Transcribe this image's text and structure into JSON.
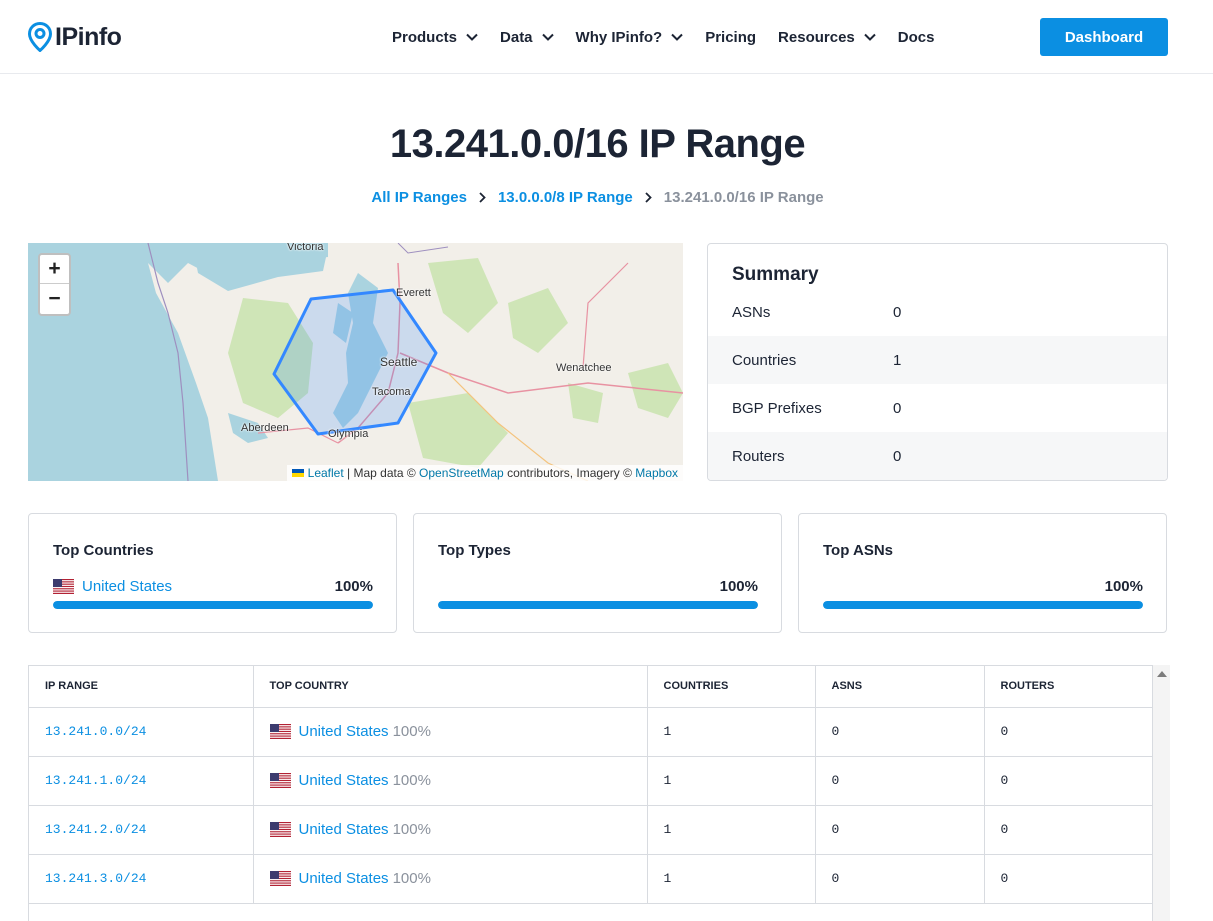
{
  "header": {
    "logo_text": "IPinfo",
    "nav": [
      {
        "label": "Products",
        "has_dropdown": true
      },
      {
        "label": "Data",
        "has_dropdown": true
      },
      {
        "label": "Why IPinfo?",
        "has_dropdown": true
      },
      {
        "label": "Pricing",
        "has_dropdown": false
      },
      {
        "label": "Resources",
        "has_dropdown": true
      },
      {
        "label": "Docs",
        "has_dropdown": false
      }
    ],
    "dashboard_label": "Dashboard"
  },
  "page": {
    "title": "13.241.0.0/16 IP Range",
    "breadcrumb": [
      "All IP Ranges",
      "13.0.0.0/8 IP Range",
      "13.241.0.0/16 IP Range"
    ]
  },
  "map": {
    "zoom_in": "+",
    "zoom_out": "−",
    "labels": [
      "Victoria",
      "Everett",
      "Seattle",
      "Wenatchee",
      "Tacoma",
      "Aberdeen",
      "Olympia"
    ],
    "attribution": {
      "leaflet": "Leaflet",
      "sep1": " | Map data © ",
      "osm": "OpenStreetMap",
      "sep2": " contributors, Imagery © ",
      "mapbox": "Mapbox"
    },
    "colors": {
      "water": "#aad3df",
      "land": "#f2efe9",
      "forest": "#cfe5b7",
      "polygon": "#3388ff"
    }
  },
  "summary": {
    "title": "Summary",
    "rows": [
      {
        "key": "ASNs",
        "value": "0"
      },
      {
        "key": "Countries",
        "value": "1"
      },
      {
        "key": "BGP Prefixes",
        "value": "0"
      },
      {
        "key": "Routers",
        "value": "0"
      }
    ]
  },
  "cards": {
    "countries": {
      "title": "Top Countries",
      "label": "United States",
      "percent": "100%",
      "fill": 1.0
    },
    "types": {
      "title": "Top Types",
      "label": "",
      "percent": "100%",
      "fill": 1.0
    },
    "asns": {
      "title": "Top ASNs",
      "label": "",
      "percent": "100%",
      "fill": 1.0
    }
  },
  "table": {
    "headers": [
      "IP RANGE",
      "TOP COUNTRY",
      "COUNTRIES",
      "ASNS",
      "ROUTERS"
    ],
    "rows": [
      {
        "range": "13.241.0.0/24",
        "country": "United States",
        "pct": "100%",
        "countries": "1",
        "asns": "0",
        "routers": "0"
      },
      {
        "range": "13.241.1.0/24",
        "country": "United States",
        "pct": "100%",
        "countries": "1",
        "asns": "0",
        "routers": "0"
      },
      {
        "range": "13.241.2.0/24",
        "country": "United States",
        "pct": "100%",
        "countries": "1",
        "asns": "0",
        "routers": "0"
      },
      {
        "range": "13.241.3.0/24",
        "country": "United States",
        "pct": "100%",
        "countries": "1",
        "asns": "0",
        "routers": "0"
      }
    ]
  },
  "colors": {
    "accent": "#0b8fe2",
    "text": "#1c2434",
    "muted": "#8a919c"
  }
}
